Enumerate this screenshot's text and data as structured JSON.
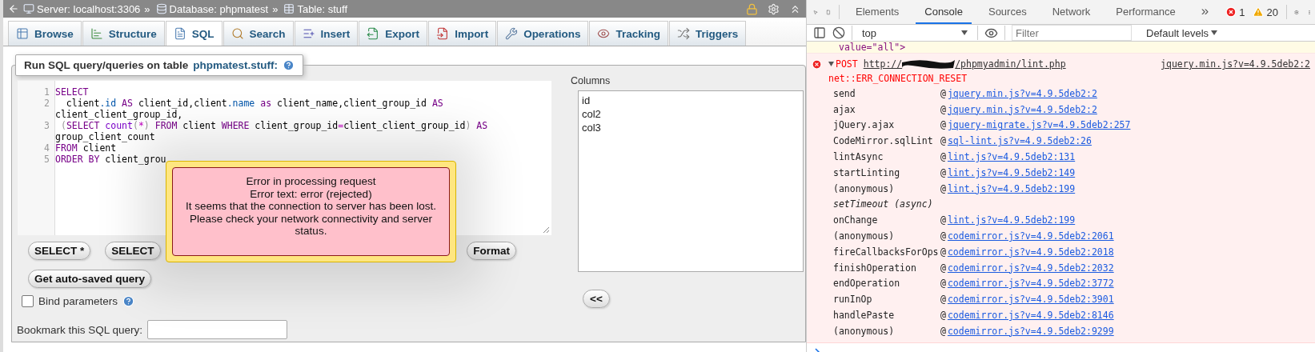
{
  "top_bar": {
    "breadcrumbs": [
      {
        "kind": "server",
        "label": "Server: localhost:3306",
        "separator": "»"
      },
      {
        "kind": "database",
        "label": "Database: phpmatest",
        "separator": "»"
      },
      {
        "kind": "table",
        "label": "Table: stuff"
      }
    ]
  },
  "tabs": [
    {
      "kind": "browse",
      "label": "Browse",
      "selected": false
    },
    {
      "kind": "structure",
      "label": "Structure",
      "selected": false
    },
    {
      "kind": "sql",
      "label": "SQL",
      "selected": true
    },
    {
      "kind": "search",
      "label": "Search",
      "selected": false
    },
    {
      "kind": "insert",
      "label": "Insert",
      "selected": false
    },
    {
      "kind": "export",
      "label": "Export",
      "selected": false
    },
    {
      "kind": "import",
      "label": "Import",
      "selected": false
    },
    {
      "kind": "operations",
      "label": "Operations",
      "selected": false
    },
    {
      "kind": "tracking",
      "label": "Tracking",
      "selected": false
    },
    {
      "kind": "triggers",
      "label": "Triggers",
      "selected": false
    }
  ],
  "query_panel": {
    "legend": "Run SQL query/queries on table ",
    "legend_link": "phpmatest.stuff:",
    "editor": {
      "lines": [
        {
          "number": "1",
          "tokens": [
            {
              "kind": "keyword",
              "text": "SELECT"
            }
          ]
        },
        {
          "number": "2",
          "tokens": [
            {
              "kind": "plain",
              "text": "  client"
            },
            {
              "kind": "property",
              "text": ".id"
            },
            {
              "kind": "keyword",
              "text": " AS"
            },
            {
              "kind": "plain",
              "text": " client_id,client"
            },
            {
              "kind": "property",
              "text": ".name"
            },
            {
              "kind": "keyword",
              "text": " as"
            },
            {
              "kind": "plain",
              "text": " client_name,client_group_id "
            },
            {
              "kind": "keyword",
              "text": "AS"
            },
            {
              "kind": "plain",
              "text": " client_client_group_id,"
            }
          ]
        },
        {
          "number": "3",
          "tokens": [
            {
              "kind": "bracket",
              "text": " ("
            },
            {
              "kind": "keyword",
              "text": "SELECT"
            },
            {
              "kind": "builtin",
              "text": " count"
            },
            {
              "kind": "bracket",
              "text": "("
            },
            {
              "kind": "operator",
              "text": "*"
            },
            {
              "kind": "bracket",
              "text": ")"
            },
            {
              "kind": "keyword",
              "text": " FROM"
            },
            {
              "kind": "plain",
              "text": " client "
            },
            {
              "kind": "keyword",
              "text": "WHERE"
            },
            {
              "kind": "plain",
              "text": " client_group_id"
            },
            {
              "kind": "operator",
              "text": "="
            },
            {
              "kind": "plain",
              "text": "client_client_group_id"
            },
            {
              "kind": "bracket",
              "text": ")"
            },
            {
              "kind": "keyword",
              "text": " AS"
            },
            {
              "kind": "plain",
              "text": " group_client_count"
            }
          ]
        },
        {
          "number": "4",
          "tokens": [
            {
              "kind": "keyword",
              "text": "FROM"
            },
            {
              "kind": "plain",
              "text": " client"
            }
          ]
        },
        {
          "number": "5",
          "tokens": [
            {
              "kind": "keyword",
              "text": "ORDER BY"
            },
            {
              "kind": "plain",
              "text": " client_grou"
            }
          ]
        }
      ]
    },
    "buttons": [
      {
        "label": "SELECT *"
      },
      {
        "label": "SELECT"
      },
      {
        "label": "Format"
      }
    ],
    "autosave_button": "Get auto-saved query",
    "bind_parameters": {
      "label": "Bind parameters",
      "checked": false
    },
    "bookmark": {
      "label": "Bookmark this SQL query:"
    },
    "columns": {
      "label": "Columns",
      "items": [
        "id",
        "col2",
        "col3"
      ],
      "insert_button": "<<"
    }
  },
  "error_dialog": {
    "lines": [
      "Error in processing request",
      "Error text: error (rejected)",
      "It seems that the connection to server has been lost.",
      "Please check your network connectivity and server status."
    ]
  },
  "devtools": {
    "tabs": [
      {
        "label": "Elements",
        "selected": false
      },
      {
        "label": "Console",
        "selected": true
      },
      {
        "label": "Sources",
        "selected": false
      },
      {
        "label": "Network",
        "selected": false
      },
      {
        "label": "Performance",
        "selected": false
      }
    ],
    "more_tabs": "»",
    "error_count": "1",
    "warning_count": "20",
    "context": "top",
    "filter": {
      "placeholder": "Filter"
    },
    "levels": "Default levels",
    "console": {
      "truncated_line": "value=\"all\">",
      "error": {
        "expanded": true,
        "method": "POST",
        "url_start": "http://",
        "url_end": "/phpmyadmin/lint.php",
        "source": "jquery.min.js?v=4.9.5deb2:2",
        "message": "net::ERR_CONNECTION_RESET"
      },
      "frames": [
        {
          "kind": "frame",
          "function": "send",
          "at": "@",
          "source": "jquery.min.js?v=4.9.5deb2:2"
        },
        {
          "kind": "frame",
          "function": "ajax",
          "at": "@",
          "source": "jquery.min.js?v=4.9.5deb2:2"
        },
        {
          "kind": "frame",
          "function": "jQuery.ajax",
          "at": "@",
          "source": "jquery-migrate.js?v=4.9.5deb2:257"
        },
        {
          "kind": "frame",
          "function": "CodeMirror.sqlLint",
          "at": "@",
          "source": "sql-lint.js?v=4.9.5deb2:26"
        },
        {
          "kind": "frame",
          "function": "lintAsync",
          "at": "@",
          "source": "lint.js?v=4.9.5deb2:131"
        },
        {
          "kind": "frame",
          "function": "startLinting",
          "at": "@",
          "source": "lint.js?v=4.9.5deb2:149"
        },
        {
          "kind": "frame",
          "function": "(anonymous)",
          "at": "@",
          "source": "lint.js?v=4.9.5deb2:199"
        },
        {
          "kind": "async",
          "function": "setTimeout (async)"
        },
        {
          "kind": "frame",
          "function": "onChange",
          "at": "@",
          "source": "lint.js?v=4.9.5deb2:199"
        },
        {
          "kind": "frame",
          "function": "(anonymous)",
          "at": "@",
          "source": "codemirror.js?v=4.9.5deb2:2061"
        },
        {
          "kind": "frame",
          "function": "fireCallbacksForOps",
          "at": "@",
          "source": "codemirror.js?v=4.9.5deb2:2018"
        },
        {
          "kind": "frame",
          "function": "finishOperation",
          "at": "@",
          "source": "codemirror.js?v=4.9.5deb2:2032"
        },
        {
          "kind": "frame",
          "function": "endOperation",
          "at": "@",
          "source": "codemirror.js?v=4.9.5deb2:3772"
        },
        {
          "kind": "frame",
          "function": "runInOp",
          "at": "@",
          "source": "codemirror.js?v=4.9.5deb2:3901"
        },
        {
          "kind": "frame",
          "function": "handlePaste",
          "at": "@",
          "source": "codemirror.js?v=4.9.5deb2:8146"
        },
        {
          "kind": "frame",
          "function": "(anonymous)",
          "at": "@",
          "source": "codemirror.js?v=4.9.5deb2:9299"
        }
      ]
    }
  }
}
